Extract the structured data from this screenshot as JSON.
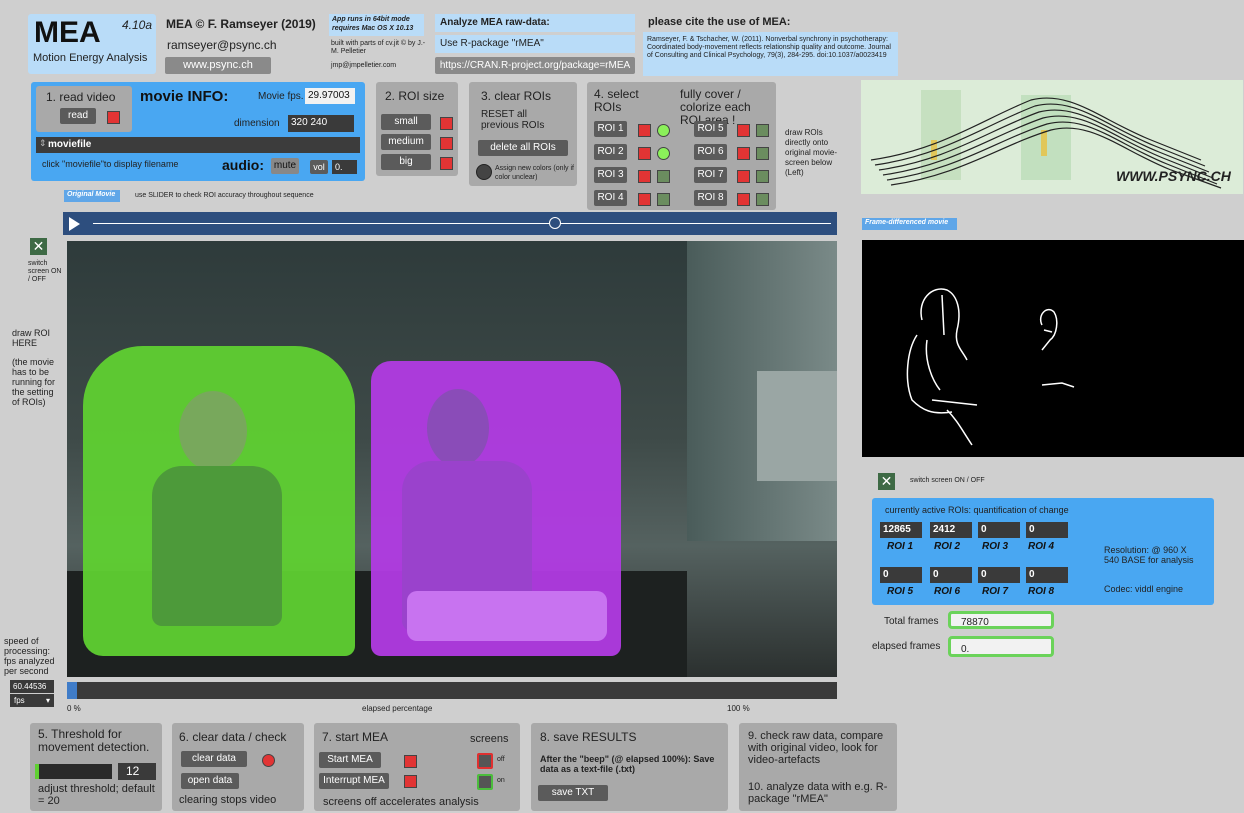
{
  "header": {
    "logo": "MEA",
    "version": "4.10a",
    "subtitle": "Motion Energy Analysis",
    "copyright": "MEA © F. Ramseyer (2019)",
    "email": "ramseyer@psync.ch",
    "website_button": "www.psync.ch",
    "app_note": "App runs in 64bit mode requires Mac OS X 10.13",
    "built_with": "built with parts of cv.jit © by J.-M. Pelletier",
    "pelletier_email": "jmp@jmpelletier.com",
    "analyze_title": "Analyze MEA raw-data:",
    "rpackage": "Use R-package \"rMEA\"",
    "cran_button": "https://CRAN.R-project.org/package=rMEA",
    "cite_title": "please cite the use of MEA:",
    "citation": "Ramseyer, F. & Tschacher, W. (2011). Nonverbal synchrony in psychotherapy: Coordinated body-movement reflects relationship quality and outcome. Journal of Consulting and Clinical Psychology, 79(3), 284-295. doi:10.1037/a0023419"
  },
  "read_video": {
    "title": "1. read video",
    "read_button": "read",
    "movie_info": "movie INFO:",
    "fps_label": "Movie fps.",
    "fps_value": "29.97003",
    "dimension_label": "dimension",
    "dimension_value": "320 240",
    "moviefile": "moviefile",
    "click_hint": "click \"moviefile\"to display  filename",
    "audio_label": "audio:",
    "mute_button": "mute",
    "vol_label": "vol",
    "vol_value": "0."
  },
  "roi_size": {
    "title": "2. ROI size",
    "small": "small",
    "medium": "medium",
    "big": "big"
  },
  "clear_rois": {
    "title": "3. clear ROIs",
    "reset_text": "RESET all previous ROIs",
    "delete_button": "delete all ROIs",
    "assign_note": "Assign new colors (only if color unclear)"
  },
  "select_rois": {
    "title": "4. select ROIs",
    "cover_text": "fully cover / colorize each ROI area !",
    "rois": [
      "ROI 1",
      "ROI 2",
      "ROI 3",
      "ROI 4",
      "ROI 5",
      "ROI 6",
      "ROI 7",
      "ROI 8"
    ]
  },
  "draw_rois_note": "draw ROIs directly onto original movie-screen below (Left)",
  "original_movie_tab": "Original Movie",
  "slider_hint": "use SLIDER to check ROI accuracy throughout sequence",
  "switch_screen_left": "switch screen ON / OFF",
  "draw_roi_here": "draw ROI HERE",
  "movie_running_note": "(the movie has to be running for the setting of ROIs)",
  "speed_note": "speed of processing: fps analyzed per second",
  "speed_value": "60.44536",
  "speed_unit": "fps",
  "progress": {
    "start_label": "0 %",
    "middle_label": "elapsed percentage",
    "end_label": "100 %"
  },
  "watermark": "WWW.PSYNC.CH",
  "frame_diff_tab": "Frame-differenced movie",
  "switch_screen_right": "switch screen ON / OFF",
  "quantification": {
    "title": "currently active ROIs: quantification of change",
    "rois": [
      {
        "label": "ROI 1",
        "value": "12865"
      },
      {
        "label": "ROI 2",
        "value": "2412"
      },
      {
        "label": "ROI 3",
        "value": "0"
      },
      {
        "label": "ROI 4",
        "value": "0"
      },
      {
        "label": "ROI 5",
        "value": "0"
      },
      {
        "label": "ROI 6",
        "value": "0"
      },
      {
        "label": "ROI 7",
        "value": "0"
      },
      {
        "label": "ROI 8",
        "value": "0"
      }
    ],
    "resolution": "Resolution: @ 960 X 540 BASE for analysis",
    "codec": "Codec: viddl engine"
  },
  "frames": {
    "total_label": "Total frames",
    "total_value": "78870",
    "elapsed_label": "elapsed frames",
    "elapsed_value": "0."
  },
  "threshold": {
    "title": "5. Threshold for movement detection.",
    "value": "12",
    "note": "adjust threshold; default = 20"
  },
  "clear_data": {
    "title": "6. clear data / check",
    "clear_button": "clear data",
    "open_button": "open data",
    "note": "clearing stops video"
  },
  "start_mea": {
    "title": "7. start MEA",
    "screens_label": "screens",
    "start_button": "Start MEA",
    "interrupt_button": "Interrupt MEA",
    "off": "off",
    "on": "on",
    "note": "screens off accelerates analysis"
  },
  "save": {
    "title": "8. save RESULTS",
    "note": "After the \"beep\" (@ elapsed 100%): Save data as a text-file (.txt)",
    "button": "save TXT"
  },
  "check": {
    "line1": "9. check raw data, compare with original video, look for video-artefacts",
    "line2": "10. analyze data with e.g. R-package \"rMEA\""
  }
}
